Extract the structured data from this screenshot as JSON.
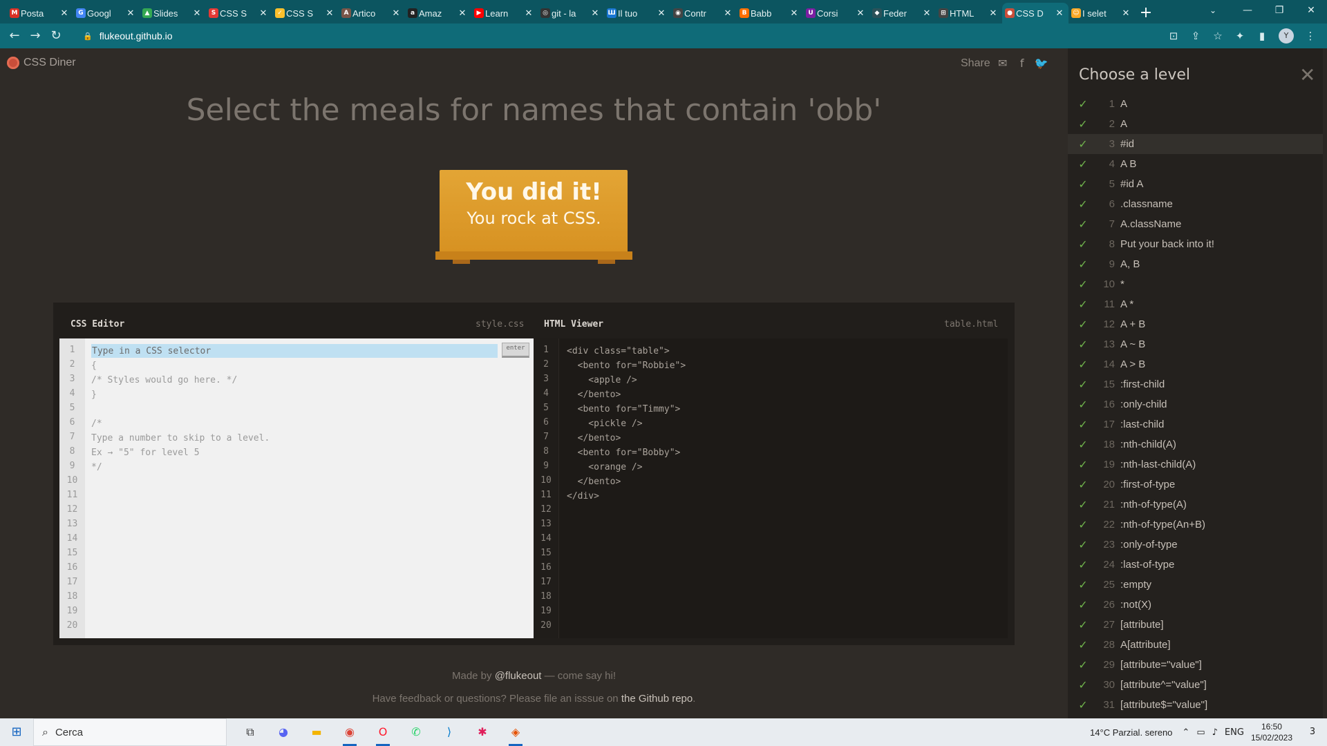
{
  "browser": {
    "tabs": [
      {
        "label": "Posta",
        "icon": "gmail-icon",
        "fav": "M",
        "color": "#d93025"
      },
      {
        "label": "Googl",
        "icon": "google-docs-icon",
        "fav": "G",
        "color": "#4285f4"
      },
      {
        "label": "Slides",
        "icon": "drive-icon",
        "fav": "▲",
        "color": "#34a853"
      },
      {
        "label": "CSS S",
        "icon": "css-selector-icon",
        "fav": "S",
        "color": "#e53935"
      },
      {
        "label": "CSS S",
        "icon": "css-selector-icon-2",
        "fav": "✓",
        "color": "#fbc02d"
      },
      {
        "label": "Artico",
        "icon": "article-icon",
        "fav": "A",
        "color": "#795548"
      },
      {
        "label": "Amaz",
        "icon": "amazon-icon",
        "fav": "a",
        "color": "#222222"
      },
      {
        "label": "Learn",
        "icon": "youtube-icon",
        "fav": "▶",
        "color": "#ff0000"
      },
      {
        "label": "git - la",
        "icon": "git-icon",
        "fav": "◎",
        "color": "#333333"
      },
      {
        "label": "Il tuo",
        "icon": "tuo-icon",
        "fav": "Ш",
        "color": "#1976d2"
      },
      {
        "label": "Contr",
        "icon": "globe-icon",
        "fav": "◉",
        "color": "#444444"
      },
      {
        "label": "Babb",
        "icon": "babbel-icon",
        "fav": "B",
        "color": "#ff6f00"
      },
      {
        "label": "Corsi",
        "icon": "udemy-icon",
        "fav": "U",
        "color": "#7b1fa2"
      },
      {
        "label": "Feder",
        "icon": "feder-icon",
        "fav": "◆",
        "color": "#2b5259"
      },
      {
        "label": "HTML",
        "icon": "html-icon",
        "fav": "⊞",
        "color": "#444444"
      },
      {
        "label": "CSS D",
        "icon": "css-diner-icon",
        "fav": "●",
        "color": "#c94e3a",
        "active": true
      },
      {
        "label": "I selet",
        "icon": "selectors-icon",
        "fav": "☺",
        "color": "#f9a825"
      }
    ],
    "new_tab": "+",
    "window_controls": {
      "tab_search": "⌄",
      "minimize": "—",
      "maximize": "❐",
      "close": "✕"
    },
    "address": {
      "back": "←",
      "forward": "→",
      "reload": "↻",
      "lock": "🔒",
      "url": "flukeout.github.io"
    },
    "right_buttons": [
      "⊡",
      "⇪",
      "☆",
      "✦",
      "▮"
    ],
    "avatar": "Y"
  },
  "header": {
    "logo": "CSS Diner",
    "share": "Share",
    "share_icons": [
      "✉",
      "f",
      "🐦"
    ]
  },
  "instructions": "Select the meals for names that contain 'obb'",
  "win": {
    "line1": "You did it!",
    "line2": "You rock at CSS."
  },
  "css_editor": {
    "title": "CSS Editor",
    "file": "style.css",
    "placeholder": "Type in a CSS selector",
    "enter": "enter",
    "line_numbers": [
      "1",
      "2",
      "3",
      "4",
      "5",
      "6",
      "7",
      "8",
      "9",
      "10",
      "11",
      "12",
      "13",
      "14",
      "15",
      "16",
      "17",
      "18",
      "19",
      "20"
    ],
    "lines": [
      "{",
      "/* Styles would go here. */",
      "}",
      "",
      "/*",
      "Type a number to skip to a level.",
      "Ex → \"5\" for level 5",
      "*/"
    ]
  },
  "html_viewer": {
    "title": "HTML Viewer",
    "file": "table.html",
    "line_numbers": [
      "1",
      "2",
      "3",
      "4",
      "5",
      "6",
      "7",
      "8",
      "9",
      "10",
      "11",
      "12",
      "13",
      "14",
      "15",
      "16",
      "17",
      "18",
      "19",
      "20"
    ],
    "lines": [
      "<div class=\"table\">",
      "  <bento for=\"Robbie\">",
      "    <apple />",
      "  </bento>",
      "  <bento for=\"Timmy\">",
      "    <pickle />",
      "  </bento>",
      "  <bento for=\"Bobby\">",
      "    <orange />",
      "  </bento>",
      "</div>"
    ]
  },
  "footer": {
    "made_by_prefix": "Made by ",
    "made_by_link": "@flukeout",
    "made_by_suffix": " — come say hi!",
    "feedback_prefix": "Have feedback or questions? Please file an isssue on ",
    "feedback_link": "the Github repo",
    "feedback_suffix": "."
  },
  "levels": {
    "title": "Choose a level",
    "close": "✕",
    "check": "✓",
    "current": 3,
    "items": [
      {
        "num": "1",
        "name": "A"
      },
      {
        "num": "2",
        "name": "A"
      },
      {
        "num": "3",
        "name": "#id"
      },
      {
        "num": "4",
        "name": "A  B"
      },
      {
        "num": "5",
        "name": "#id  A"
      },
      {
        "num": "6",
        "name": ".classname"
      },
      {
        "num": "7",
        "name": "A.className"
      },
      {
        "num": "8",
        "name": "Put your back into it!"
      },
      {
        "num": "9",
        "name": "A, B"
      },
      {
        "num": "10",
        "name": "*"
      },
      {
        "num": "11",
        "name": "A  *"
      },
      {
        "num": "12",
        "name": "A + B"
      },
      {
        "num": "13",
        "name": "A ~ B"
      },
      {
        "num": "14",
        "name": "A > B"
      },
      {
        "num": "15",
        "name": ":first-child"
      },
      {
        "num": "16",
        "name": ":only-child"
      },
      {
        "num": "17",
        "name": ":last-child"
      },
      {
        "num": "18",
        "name": ":nth-child(A)"
      },
      {
        "num": "19",
        "name": ":nth-last-child(A)"
      },
      {
        "num": "20",
        "name": ":first-of-type"
      },
      {
        "num": "21",
        "name": ":nth-of-type(A)"
      },
      {
        "num": "22",
        "name": ":nth-of-type(An+B)"
      },
      {
        "num": "23",
        "name": ":only-of-type"
      },
      {
        "num": "24",
        "name": ":last-of-type"
      },
      {
        "num": "25",
        "name": ":empty"
      },
      {
        "num": "26",
        "name": ":not(X)"
      },
      {
        "num": "27",
        "name": "[attribute]"
      },
      {
        "num": "28",
        "name": "A[attribute]"
      },
      {
        "num": "29",
        "name": "[attribute=\"value\"]"
      },
      {
        "num": "30",
        "name": "[attribute^=\"value\"]"
      },
      {
        "num": "31",
        "name": "[attribute$=\"value\"]"
      }
    ]
  },
  "taskbar": {
    "start": "⊞",
    "search": "Cerca",
    "search_icon": "⌕",
    "apps": [
      {
        "name": "task-view-icon",
        "glyph": "⧉",
        "color": "#333333"
      },
      {
        "name": "discord-icon",
        "glyph": "◕",
        "color": "#5865f2"
      },
      {
        "name": "file-explorer-icon",
        "glyph": "▬",
        "color": "#f3b400"
      },
      {
        "name": "chrome-icon",
        "glyph": "◉",
        "color": "#db4437",
        "active": true
      },
      {
        "name": "opera-icon",
        "glyph": "O",
        "color": "#ff1b2d",
        "active": true
      },
      {
        "name": "whatsapp-icon",
        "glyph": "✆",
        "color": "#25d366"
      },
      {
        "name": "vscode-icon",
        "glyph": "⟩",
        "color": "#007acc"
      },
      {
        "name": "slack-icon",
        "glyph": "✱",
        "color": "#e01e5a"
      },
      {
        "name": "app-icon",
        "glyph": "◈",
        "color": "#e65100",
        "active": true
      }
    ],
    "weather": "14°C  Parzial. sereno",
    "language": "ENG",
    "time": "16:50",
    "date": "15/02/2023",
    "notifications": "3"
  }
}
